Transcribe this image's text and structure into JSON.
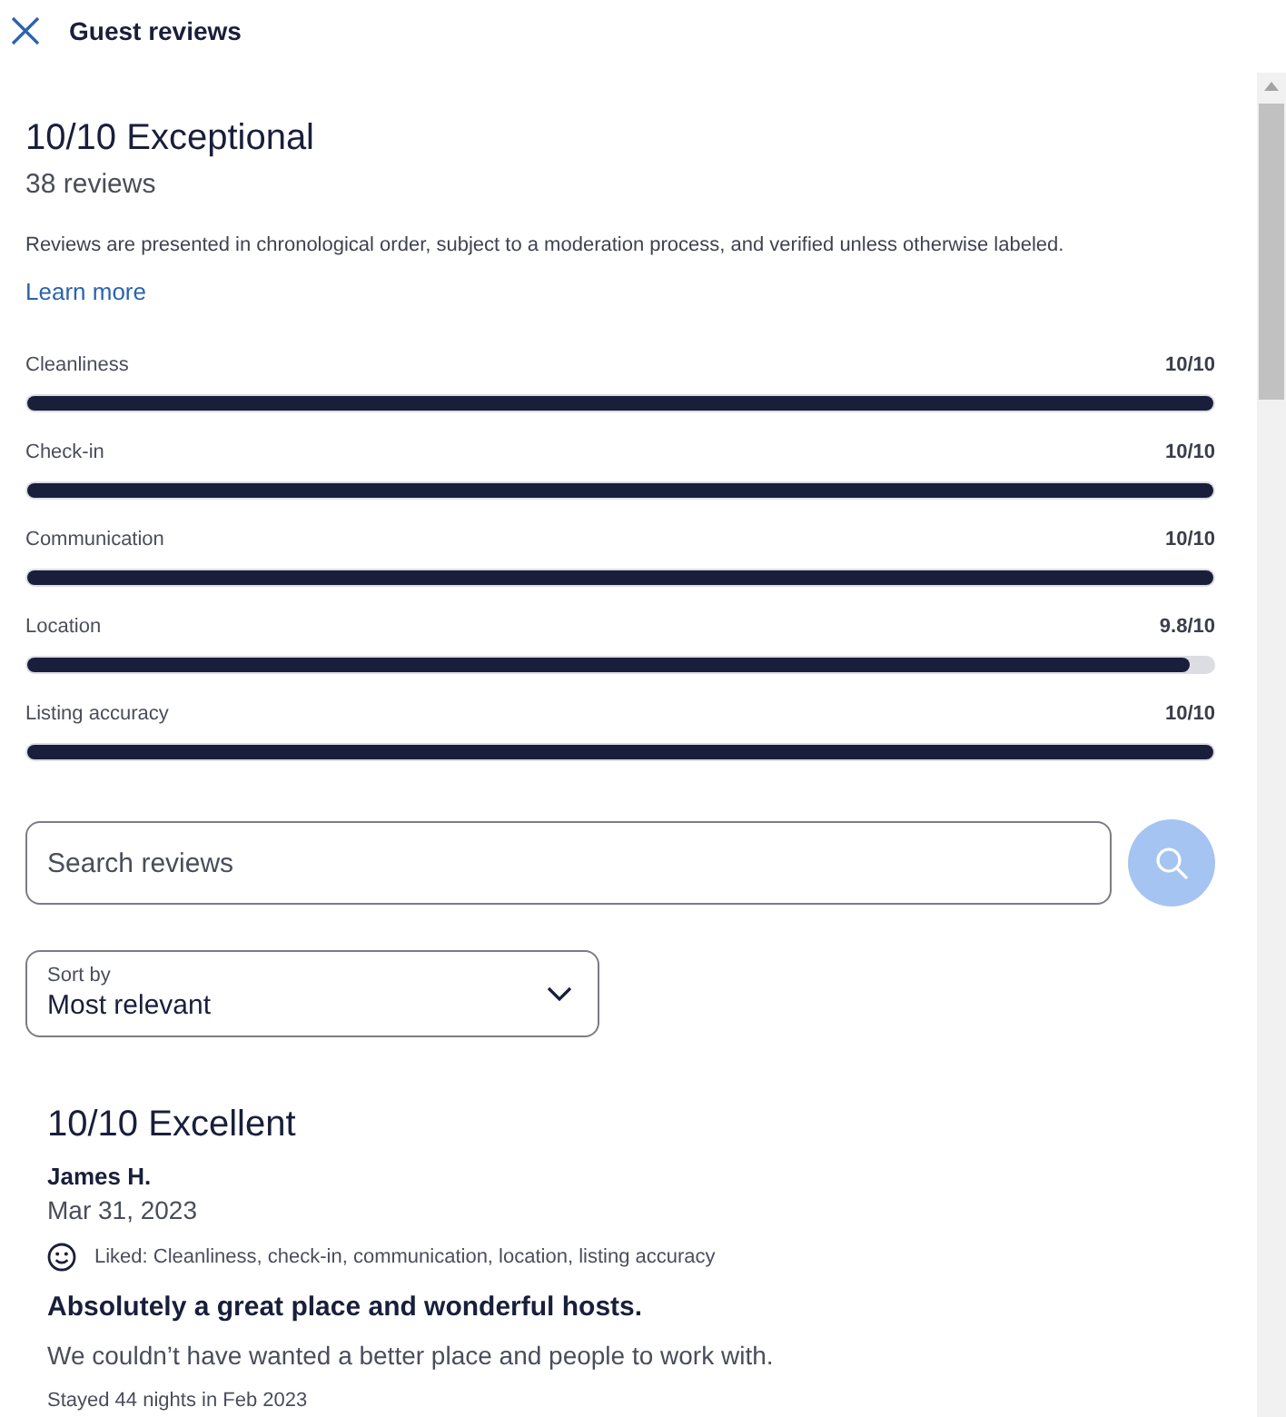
{
  "header": {
    "title": "Guest reviews"
  },
  "summary": {
    "score": "10/10 Exceptional",
    "count": "38 reviews",
    "disclaimer": "Reviews are presented in chronological order, subject to a moderation process, and verified unless otherwise labeled.",
    "link": "Learn more"
  },
  "ratings": [
    {
      "label": "Cleanliness",
      "reading": "10/10",
      "level": 1
    },
    {
      "label": "Check-in",
      "reading": "10/10",
      "level": 1
    },
    {
      "label": "Communication",
      "reading": "10/10",
      "level": 1
    },
    {
      "label": "Location",
      "reading": "9.8/10",
      "level": 0.98
    },
    {
      "label": "Listing accuracy",
      "reading": "10/10",
      "level": 1
    }
  ],
  "search": {
    "placeholder": "Search reviews"
  },
  "sort": {
    "label": "Sort by",
    "value": "Most relevant"
  },
  "reviews": [
    {
      "score": "10/10 Excellent",
      "author": "James H.",
      "date": "Mar 31, 2023",
      "liked": "Liked: Cleanliness, check-in, communication, location, listing accuracy",
      "title": "Absolutely a great place and wonderful hosts.",
      "body": "We couldn’t have wanted a better place and people to work with.",
      "stay": "Stayed 44 nights in Feb 2023"
    }
  ]
}
